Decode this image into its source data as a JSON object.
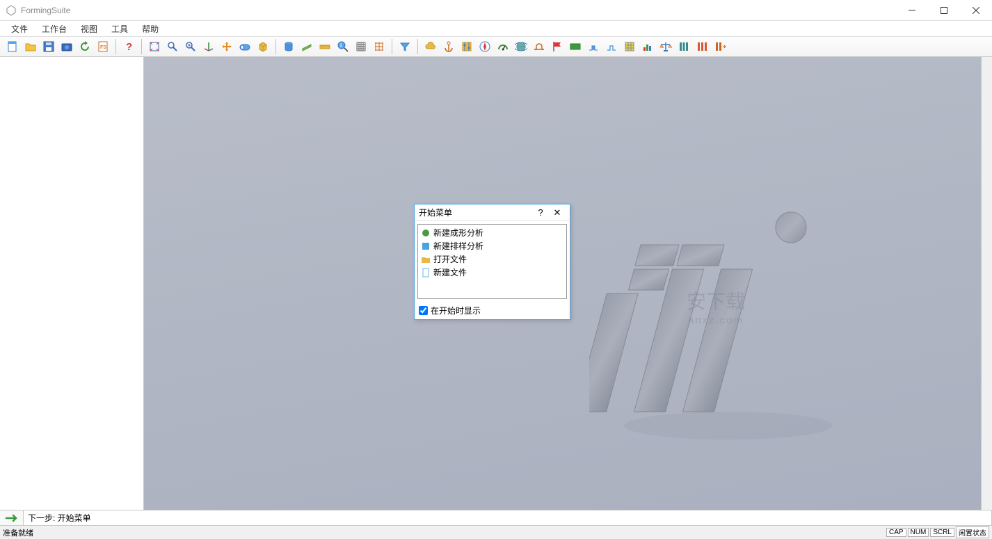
{
  "app": {
    "title": "FormingSuite"
  },
  "menu": {
    "file": "文件",
    "workbench": "工作台",
    "view": "视图",
    "tools": "工具",
    "help": "帮助"
  },
  "toolbar_icons": {
    "new": "new-file-icon",
    "open": "open-folder-icon",
    "save": "save-icon",
    "camera": "camera-icon",
    "refresh": "refresh-icon",
    "fs": "fs-script-icon",
    "help": "help-icon",
    "fit": "fit-view-icon",
    "zoom": "zoom-icon",
    "zoom_in": "zoom-in-icon",
    "coord": "coord-triad-icon",
    "pan": "pan-icon",
    "section": "section-view-icon",
    "box": "box-icon",
    "cylinder": "cylinder-icon",
    "sheet": "sheet-icon",
    "measure": "measure-icon",
    "info": "info-cursor-icon",
    "grid1": "grid-dense-icon",
    "grid2": "grid-sparse-icon",
    "filter": "filter-icon",
    "cloud": "cloud-icon",
    "anchor": "anchor-icon",
    "settings": "settings-icon",
    "compass": "compass-icon",
    "gauge": "gauge-icon",
    "globe": "globe-icon",
    "bridge": "bridge-icon",
    "flag": "flag-icon",
    "panel": "panel-icon",
    "shape1": "shape-blue-icon",
    "shape2": "shape-outline-icon",
    "mesh": "mesh-grid-icon",
    "chart": "chart-icon",
    "balance": "balance-icon",
    "columns": "columns-icon",
    "bars1": "bars-red-icon",
    "bars2": "bars-arrow-icon"
  },
  "dialog": {
    "title": "开始菜单",
    "items": [
      {
        "label": "新建成形分析",
        "color": "#4a9b3f"
      },
      {
        "label": "新建排样分析",
        "color": "#4aa3df"
      },
      {
        "label": "打开文件",
        "color": "#e8b84a"
      },
      {
        "label": "新建文件",
        "color": "#6bb8e0"
      }
    ],
    "show_on_start": "在开始时显示"
  },
  "watermark": {
    "main": "安下载",
    "sub": "anxz.com"
  },
  "nextbar": {
    "label": "下一步: 开始菜单"
  },
  "status": {
    "ready": "准备就绪",
    "cap": "CAP",
    "num": "NUM",
    "scrl": "SCRL",
    "idle": "闲置状态"
  }
}
